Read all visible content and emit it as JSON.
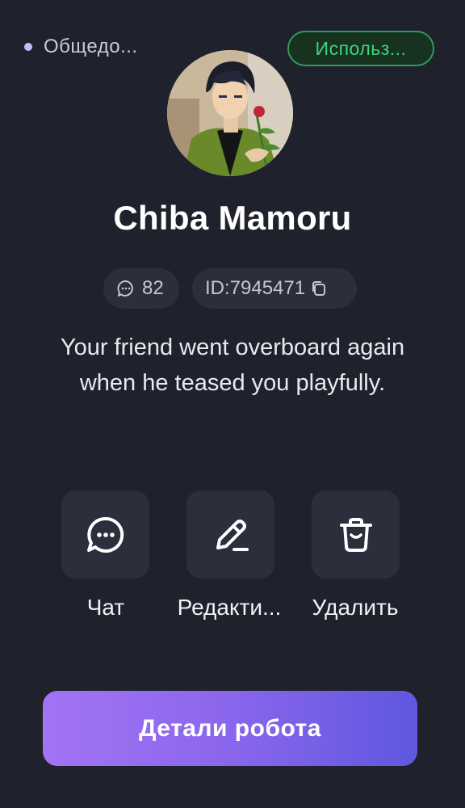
{
  "header": {
    "visibility_label": "Общедо...",
    "use_button_label": "Использ..."
  },
  "character": {
    "name": "Chiba Mamoru",
    "message_count": "82",
    "id_label": "ID:7945471",
    "description": "Your friend went overboard again when he teased you playfully."
  },
  "actions": {
    "chat_label": "Чат",
    "edit_label": "Редакти...",
    "delete_label": "Удалить"
  },
  "footer": {
    "details_button_label": "Детали робота"
  },
  "colors": {
    "background": "#1f212c",
    "use_button_text": "#3ed57c",
    "use_button_border": "#2f9b5e",
    "chip_bg": "#2c2f3b",
    "gradient_start": "#a374f4",
    "gradient_end": "#5f58df"
  },
  "icons": {
    "visibility": "status-dot",
    "count": "chat-bubble-dots-icon",
    "copy": "copy-icon",
    "chat": "chat-bubble-icon",
    "edit": "pencil-icon",
    "delete": "trash-icon"
  }
}
